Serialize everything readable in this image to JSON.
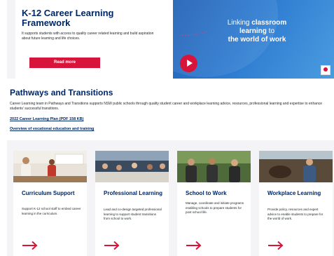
{
  "hero": {
    "title": "K-12 Career Learning Framework",
    "description": "It supports students with access to quality career related learning and build aspiration about future learning and life choices.",
    "button_label": "Read more"
  },
  "promo": {
    "line1_pre": "Linking ",
    "line1_bold": "classroom",
    "line2_bold": "learning",
    "line2_post": " to",
    "line3_bold": "the world of work"
  },
  "section": {
    "title": "Pathways and Transitions",
    "description": "Career Learning team in Pathways and Transitions supports NSW public schools through quality student career and workplace learning advice, resources, professional learning and expertise to enhance students' successful transitions.",
    "links": [
      "2022 Career Learning Plan (PDF 158 KB)",
      "Overview of vocational education and training"
    ]
  },
  "cards": [
    {
      "title": "Curriculum Support",
      "description": "Support K-12 school staff to embed career learning in the curriculum."
    },
    {
      "title": "Professional Learning",
      "description": "Lead and co-design targeted professional learning to support student transitions from school to work."
    },
    {
      "title": "School to Work",
      "description": "Manage, coordinate and initiate programs enabling schools to prepare students for post school life."
    },
    {
      "title": "Workplace Learning",
      "description": "Provide policy, resources and expert advice to enable students to prepare for the world of work."
    }
  ],
  "colors": {
    "navy": "#002664",
    "red": "#d7153a",
    "light_bg": "#f4f4f7"
  }
}
